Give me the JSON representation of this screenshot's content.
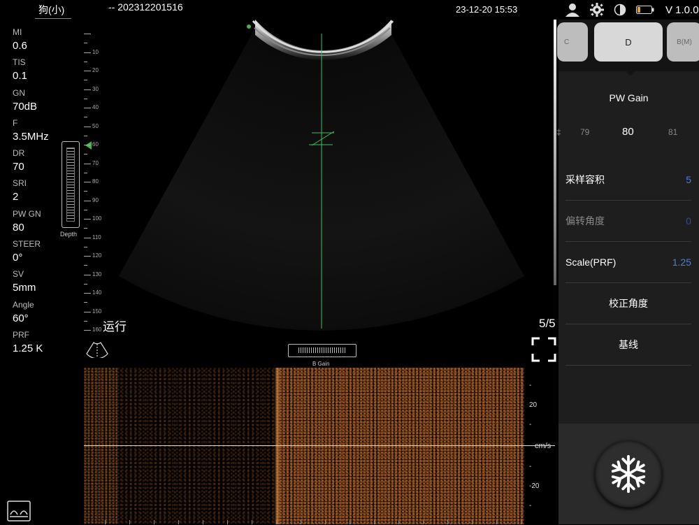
{
  "header": {
    "patient": "狗(小)",
    "study": "--  202312201516",
    "datetime": "23-12-20 15:53",
    "version": "V 1.0.0",
    "icons": [
      "user-icon",
      "gear-icon",
      "contrast-icon",
      "battery-icon"
    ]
  },
  "params": [
    {
      "label": "MI",
      "value": "0.6"
    },
    {
      "label": "TIS",
      "value": "0.1"
    },
    {
      "label": "GN",
      "value": "70dB"
    },
    {
      "label": "F",
      "value": "3.5MHz"
    },
    {
      "label": "DR",
      "value": "70"
    },
    {
      "label": "SRI",
      "value": "2"
    },
    {
      "label": "PW GN",
      "value": "80"
    },
    {
      "label": "STEER",
      "value": "0°"
    },
    {
      "label": "SV",
      "value": "5mm"
    },
    {
      "label": "Angle",
      "value": "60°"
    },
    {
      "label": "PRF",
      "value": "1.25 K"
    }
  ],
  "depth": {
    "label": "Depth",
    "ticks": [
      "10",
      "20",
      "30",
      "40",
      "50",
      "60",
      "70",
      "80",
      "90",
      "100",
      "110",
      "120",
      "130",
      "140",
      "150",
      "160"
    ]
  },
  "image": {
    "run_label": "运行",
    "frame": "5/5",
    "bgain_label": "B Gain"
  },
  "spectrum": {
    "scale_top": "20",
    "scale_bottom": "-20",
    "unit": "cm/s"
  },
  "panel": {
    "modes": [
      "C",
      "D",
      "B(M)"
    ],
    "active_mode": "D",
    "pw_gain_title": "PW Gain",
    "pw_values": [
      "79",
      "80",
      "81"
    ],
    "rows": [
      {
        "label": "采样容积",
        "value": "5"
      },
      {
        "label": "偏转角度",
        "value": "0"
      },
      {
        "label": "Scale(PRF)",
        "value": "1.25"
      }
    ],
    "buttons": [
      "校正角度",
      "基线"
    ],
    "freeze_icon": "snowflake-icon"
  },
  "colors": {
    "accent": "#4a7fe0",
    "marker": "#4caf50",
    "doppler": "#b06a2e"
  }
}
